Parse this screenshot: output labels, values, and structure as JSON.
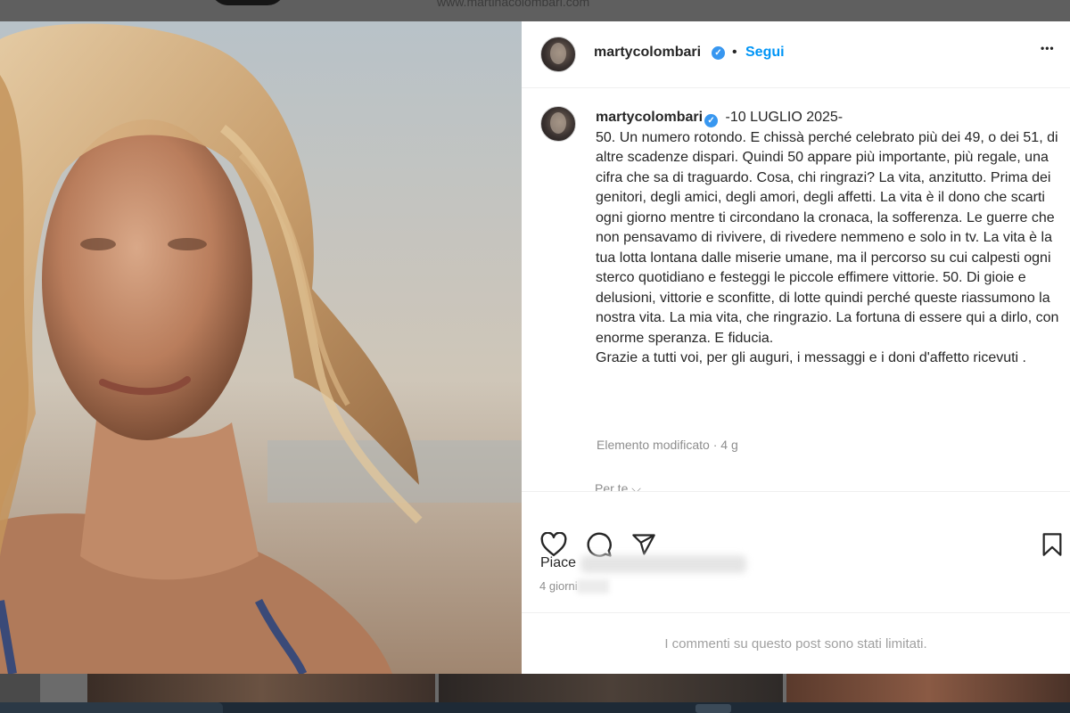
{
  "background": {
    "url_text": "www.martinacolombari.com"
  },
  "post": {
    "username": "martycolombari",
    "separator": "•",
    "follow_label": "Segui",
    "more_label": "•••",
    "caption": {
      "username": "martycolombari",
      "paragraphs": [
        "-10 LUGLIO 2025-",
        "50. Un numero rotondo. E chissà perché celebrato più dei 49, o dei 51, di altre scadenze dispari. Quindi 50 appare più importante, più regale, una cifra che sa di traguardo. Cosa, chi ringrazi? La vita, anzitutto. Prima dei genitori, degli amici, degli amori, degli affetti. La vita è il dono che scarti ogni giorno mentre ti circondano la cronaca, la sofferenza. Le guerre che non pensavamo di rivivere, di rivedere nemmeno e solo in tv. La vita è la tua lotta lontana dalle miserie umane, ma il percorso su cui calpesti ogni sterco quotidiano e festeggi le piccole effimere vittorie. 50. Di gioie e delusioni, vittorie e sconfitte, di lotte quindi perché queste riassumono la nostra vita. La mia vita, che ringrazio. La fortuna di essere qui a dirlo, con enorme speranza. E fiducia.",
        "Grazie a tutti voi, per gli auguri, i messaggi e i doni d'affetto ricevuti ."
      ],
      "edited_meta": "Elemento modificato · 4 g",
      "translate_label": "Per te ⌵"
    },
    "actions": {
      "like_icon": "heart-icon",
      "comment_icon": "comment-icon",
      "share_icon": "share-icon",
      "save_icon": "bookmark-icon"
    },
    "likes_prefix": "Piace",
    "date": "4 giorni",
    "comments_limited": "I commenti su questo post sono stati limitati."
  },
  "colors": {
    "accent": "#0095f6",
    "verified": "#3897f0",
    "muted": "#8e8e8e"
  }
}
